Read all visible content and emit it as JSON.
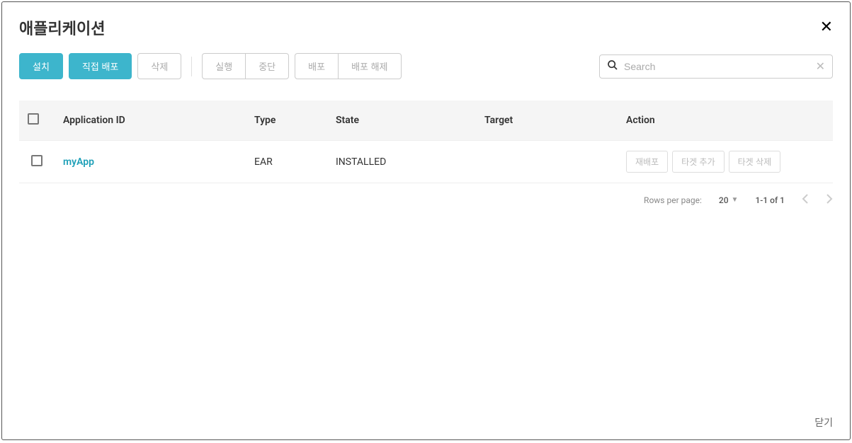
{
  "modal": {
    "title": "애플리케이션",
    "close_footer": "닫기"
  },
  "toolbar": {
    "install": "설치",
    "direct_deploy": "직접 배포",
    "delete": "삭제",
    "run": "실행",
    "stop": "중단",
    "deploy": "배포",
    "undeploy": "배포 해제"
  },
  "search": {
    "placeholder": "Search"
  },
  "table": {
    "headers": {
      "app_id": "Application ID",
      "type": "Type",
      "state": "State",
      "target": "Target",
      "action": "Action"
    },
    "rows": [
      {
        "app_id": "myApp",
        "type": "EAR",
        "state": "INSTALLED",
        "target": "",
        "actions": {
          "redeploy": "재배포",
          "add_target": "타겟 추가",
          "delete_target": "타겟 삭제"
        }
      }
    ]
  },
  "pagination": {
    "rows_label": "Rows per page:",
    "rows_value": "20",
    "range": "1-1 of 1"
  }
}
